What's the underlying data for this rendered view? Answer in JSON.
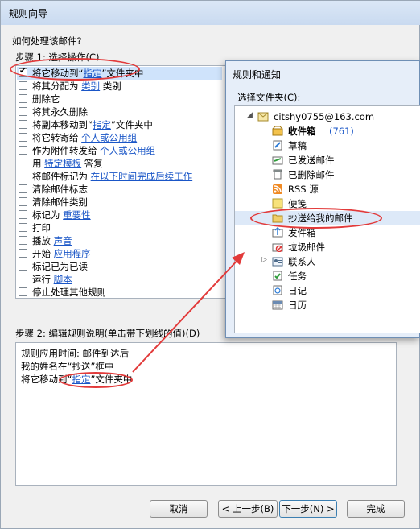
{
  "window": {
    "title": "规则向导",
    "question": "如何处理该邮件?",
    "step1_label": "步骤 1: 选择操作(C)",
    "step2_label": "步骤 2: 编辑规则说明(单击带下划线的值)(D)"
  },
  "actions": [
    {
      "pre": "将它移动到“",
      "link": "指定",
      "post": "”文件夹中",
      "checked": true,
      "selected": true
    },
    {
      "pre": "将其分配为 ",
      "link": "类别",
      "post": " 类别",
      "checked": false
    },
    {
      "pre": "删除它",
      "link": "",
      "post": "",
      "checked": false
    },
    {
      "pre": "将其永久删除",
      "link": "",
      "post": "",
      "checked": false
    },
    {
      "pre": "将副本移动到“",
      "link": "指定",
      "post": "”文件夹中",
      "checked": false
    },
    {
      "pre": "将它转寄给 ",
      "link": "个人或公用组",
      "post": "",
      "checked": false
    },
    {
      "pre": "作为附件转发给 ",
      "link": "个人或公用组",
      "post": "",
      "checked": false
    },
    {
      "pre": "用 ",
      "link": "特定模板",
      "post": " 答复",
      "checked": false
    },
    {
      "pre": "将邮件标记为 ",
      "link": "在以下时间完成后续工作",
      "post": "",
      "checked": false
    },
    {
      "pre": "清除邮件标志",
      "link": "",
      "post": "",
      "checked": false
    },
    {
      "pre": "清除邮件类别",
      "link": "",
      "post": "",
      "checked": false
    },
    {
      "pre": "标记为 ",
      "link": "重要性",
      "post": "",
      "checked": false
    },
    {
      "pre": "打印",
      "link": "",
      "post": "",
      "checked": false
    },
    {
      "pre": "播放 ",
      "link": "声音",
      "post": "",
      "checked": false
    },
    {
      "pre": "开始 ",
      "link": "应用程序",
      "post": "",
      "checked": false
    },
    {
      "pre": "标记已为已读",
      "link": "",
      "post": "",
      "checked": false
    },
    {
      "pre": "运行 ",
      "link": "脚本",
      "post": "",
      "checked": false
    },
    {
      "pre": "停止处理其他规则",
      "link": "",
      "post": "",
      "checked": false
    }
  ],
  "description": {
    "line1": "规则应用时间: 邮件到达后",
    "line2": "我的姓名在“抄送”框中",
    "line3_pre": "将它移动到“",
    "line3_link": "指定",
    "line3_post": "”文件夹中"
  },
  "buttons": {
    "cancel": "取消",
    "back": "< 上一步(B)",
    "next": "下一步(N) >",
    "finish": "完成"
  },
  "folder_dialog": {
    "title": "规则和通知",
    "select_label": "选择文件夹(C):",
    "account": "citshy0755@163.com",
    "inbox_count": "(761)",
    "folders": [
      {
        "name": "收件箱",
        "icon": "inbox-icon",
        "bold": true
      },
      {
        "name": "草稿",
        "icon": "drafts-icon",
        "bold": false
      },
      {
        "name": "已发送邮件",
        "icon": "sent-icon",
        "bold": false
      },
      {
        "name": "已删除邮件",
        "icon": "trash-icon",
        "bold": false
      },
      {
        "name": "RSS 源",
        "icon": "rss-icon",
        "bold": false
      },
      {
        "name": "便笺",
        "icon": "notes-icon",
        "bold": false
      },
      {
        "name": "抄送给我的邮件",
        "icon": "folder-icon",
        "bold": false,
        "selected": true
      },
      {
        "name": "发件箱",
        "icon": "outbox-icon",
        "bold": false
      },
      {
        "name": "垃圾邮件",
        "icon": "junk-icon",
        "bold": false
      },
      {
        "name": "联系人",
        "icon": "contacts-icon",
        "bold": false,
        "expandable": true
      },
      {
        "name": "任务",
        "icon": "tasks-icon",
        "bold": false
      },
      {
        "name": "日记",
        "icon": "journal-icon",
        "bold": false
      },
      {
        "name": "日历",
        "icon": "calendar-icon",
        "bold": false
      }
    ]
  },
  "colors": {
    "link": "#1a56c7",
    "annotation": "#e23a3a",
    "selection": "#cfe3fb"
  }
}
